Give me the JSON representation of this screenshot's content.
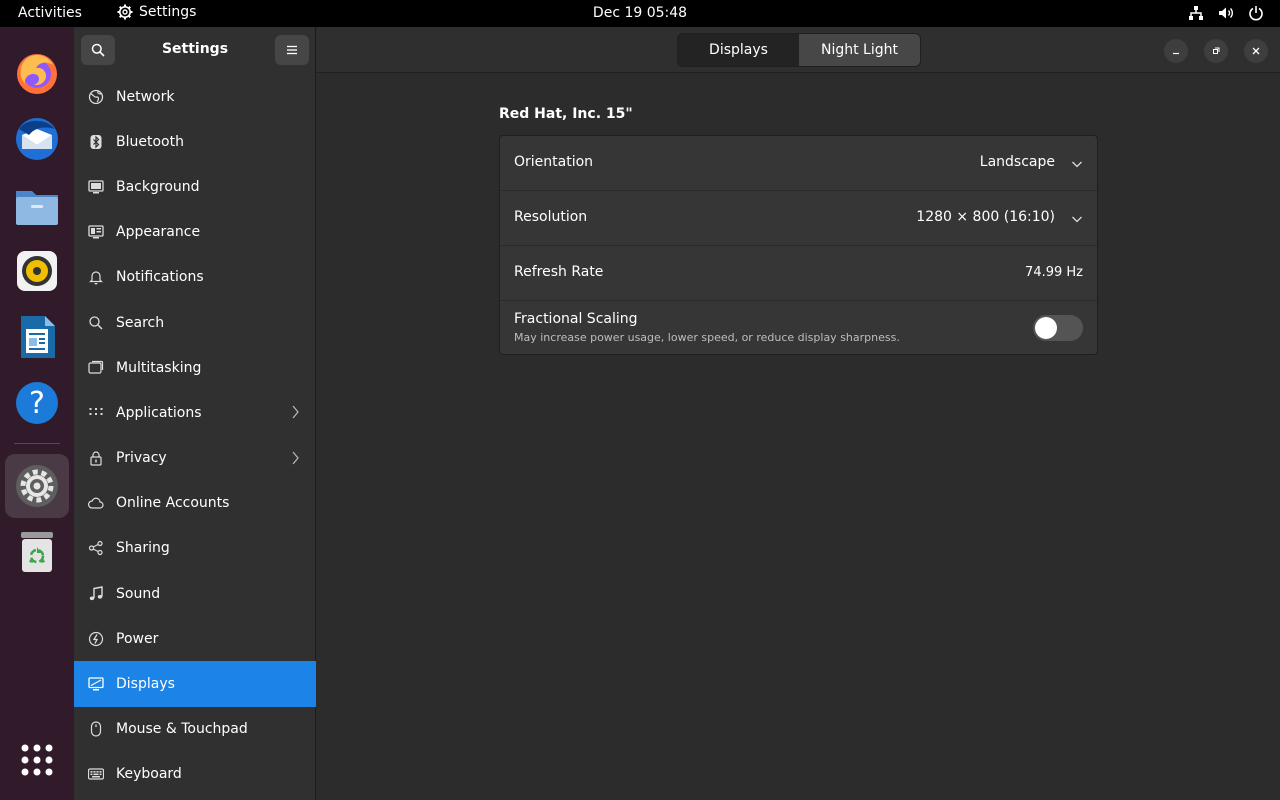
{
  "topbar": {
    "activities": "Activities",
    "app_name": "Settings",
    "clock": "Dec 19  05:48"
  },
  "dock": {
    "items": [
      {
        "name": "Firefox",
        "icon": "firefox-icon"
      },
      {
        "name": "Thunderbird",
        "icon": "thunderbird-icon"
      },
      {
        "name": "Files",
        "icon": "files-icon"
      },
      {
        "name": "Rhythmbox",
        "icon": "rhythmbox-icon"
      },
      {
        "name": "LibreOffice Writer",
        "icon": "writer-icon"
      },
      {
        "name": "Help",
        "icon": "help-icon"
      },
      {
        "name": "Settings",
        "icon": "settings-icon",
        "active": true
      },
      {
        "name": "Trash",
        "icon": "trash-icon"
      },
      {
        "name": "Show Applications",
        "icon": "app-grid-icon"
      }
    ]
  },
  "sidebar": {
    "title": "Settings",
    "items": [
      {
        "label": "Network",
        "icon": "globe-icon"
      },
      {
        "label": "Bluetooth",
        "icon": "bluetooth-icon"
      },
      {
        "label": "Background",
        "icon": "background-icon"
      },
      {
        "label": "Appearance",
        "icon": "appearance-icon"
      },
      {
        "label": "Notifications",
        "icon": "bell-icon"
      },
      {
        "label": "Search",
        "icon": "search-icon"
      },
      {
        "label": "Multitasking",
        "icon": "multitasking-icon"
      },
      {
        "label": "Applications",
        "icon": "apps-grid-icon",
        "chevron": true
      },
      {
        "label": "Privacy",
        "icon": "lock-icon",
        "chevron": true
      },
      {
        "label": "Online Accounts",
        "icon": "cloud-icon"
      },
      {
        "label": "Sharing",
        "icon": "share-icon"
      },
      {
        "label": "Sound",
        "icon": "music-note-icon"
      },
      {
        "label": "Power",
        "icon": "power-icon"
      },
      {
        "label": "Displays",
        "icon": "display-icon",
        "selected": true
      },
      {
        "label": "Mouse & Touchpad",
        "icon": "mouse-icon"
      },
      {
        "label": "Keyboard",
        "icon": "keyboard-icon"
      }
    ]
  },
  "header": {
    "tabs": [
      {
        "label": "Displays",
        "active": true
      },
      {
        "label": "Night Light",
        "active": false
      }
    ]
  },
  "display": {
    "monitor_name": "Red Hat, Inc. 15\"",
    "orientation": {
      "label": "Orientation",
      "value": "Landscape"
    },
    "resolution": {
      "label": "Resolution",
      "value": "1280 × 800 (16:10)"
    },
    "refresh_rate": {
      "label": "Refresh Rate",
      "value": "74.99 Hz"
    },
    "fractional_scaling": {
      "label": "Fractional Scaling",
      "description": "May increase power usage, lower speed, or reduce display sharpness.",
      "enabled": false
    }
  },
  "colors": {
    "accent": "#1c84e6",
    "topbar": "#000000",
    "dock": "#311b2b",
    "sidebar": "#303030",
    "content": "#2c2c2c"
  }
}
